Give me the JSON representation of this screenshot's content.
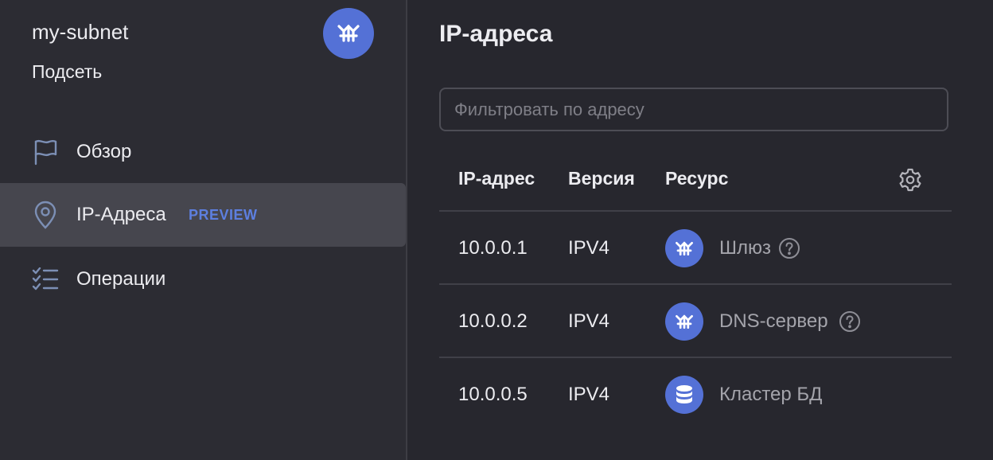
{
  "sidebar": {
    "title": "my-subnet",
    "subtitle": "Подсеть",
    "items": [
      {
        "label": "Обзор",
        "icon": "flag-icon"
      },
      {
        "label": "IP-Адреса",
        "icon": "location-pin-icon",
        "badge": "PREVIEW",
        "active": true
      },
      {
        "label": "Операции",
        "icon": "checklist-icon"
      }
    ]
  },
  "main": {
    "title": "IP-адреса",
    "filter": {
      "placeholder": "Фильтровать по адресу",
      "value": ""
    },
    "table": {
      "columns": [
        "IP-адрес",
        "Версия",
        "Ресурс"
      ],
      "rows": [
        {
          "ip": "10.0.0.1",
          "version": "IPV4",
          "resource": "Шлюз",
          "icon": "network-icon",
          "help": true
        },
        {
          "ip": "10.0.0.2",
          "version": "IPV4",
          "resource": "DNS-сервер",
          "icon": "network-icon",
          "help": true
        },
        {
          "ip": "10.0.0.5",
          "version": "IPV4",
          "resource": "Кластер БД",
          "icon": "database-icon",
          "help": false
        }
      ]
    }
  },
  "colors": {
    "accent": "#5471d6",
    "badge": "#5d7fe0",
    "sidebar_bg": "#2c2c33",
    "main_bg": "#27272e",
    "active_bg": "#46464e"
  }
}
